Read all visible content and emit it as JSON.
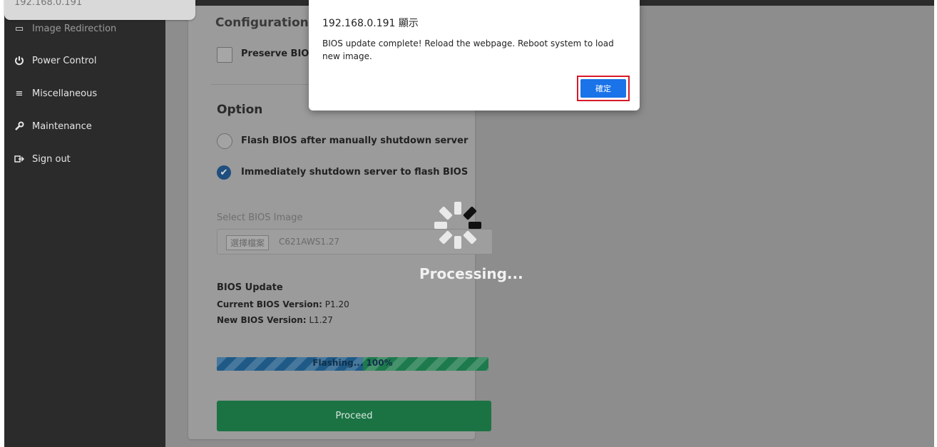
{
  "browser": {
    "url_tab_text": "192.168.0.191"
  },
  "sidebar": {
    "items": [
      {
        "label": "Image Redirection",
        "icon": "image-icon"
      },
      {
        "label": "Power Control",
        "icon": "power-icon"
      },
      {
        "label": "Miscellaneous",
        "icon": "menu-icon"
      },
      {
        "label": "Maintenance",
        "icon": "wrench-icon"
      },
      {
        "label": "Sign out",
        "icon": "sign-out-icon"
      }
    ]
  },
  "main": {
    "config_heading": "Configuration",
    "preserve_label": "Preserve BIOS config",
    "option_title": "Option",
    "radio_options": [
      {
        "label": "Flash BIOS after manually shutdown server",
        "checked": false
      },
      {
        "label": "Immediately shutdown server to flash BIOS",
        "checked": true
      }
    ],
    "select_image_label": "Select BIOS Image",
    "file_button": "選擇檔案",
    "file_name": "C621AWS1.27",
    "bios_update_heading": "BIOS Update",
    "current_version_label": "Current BIOS Version:",
    "current_version_value": "P1.20",
    "new_version_label": "New BIOS Version:",
    "new_version_value": "L1.27",
    "progress_text": "Flashing... 100%",
    "progress_value": 1.0,
    "proceed_button": "Proceed"
  },
  "overlay": {
    "processing_text": "Processing..."
  },
  "dialog": {
    "title": "192.168.0.191 顯示",
    "message": "BIOS update complete! Reload the webpage. Reboot system to load new image.",
    "ok_button": "確定"
  },
  "colors": {
    "sidebar_bg": "#2b2b2b",
    "overlay_bg": "#8d8d8d",
    "ok_button": "#1a73e8",
    "highlight_box": "#d7192a",
    "proceed_green": "#1b7344"
  }
}
